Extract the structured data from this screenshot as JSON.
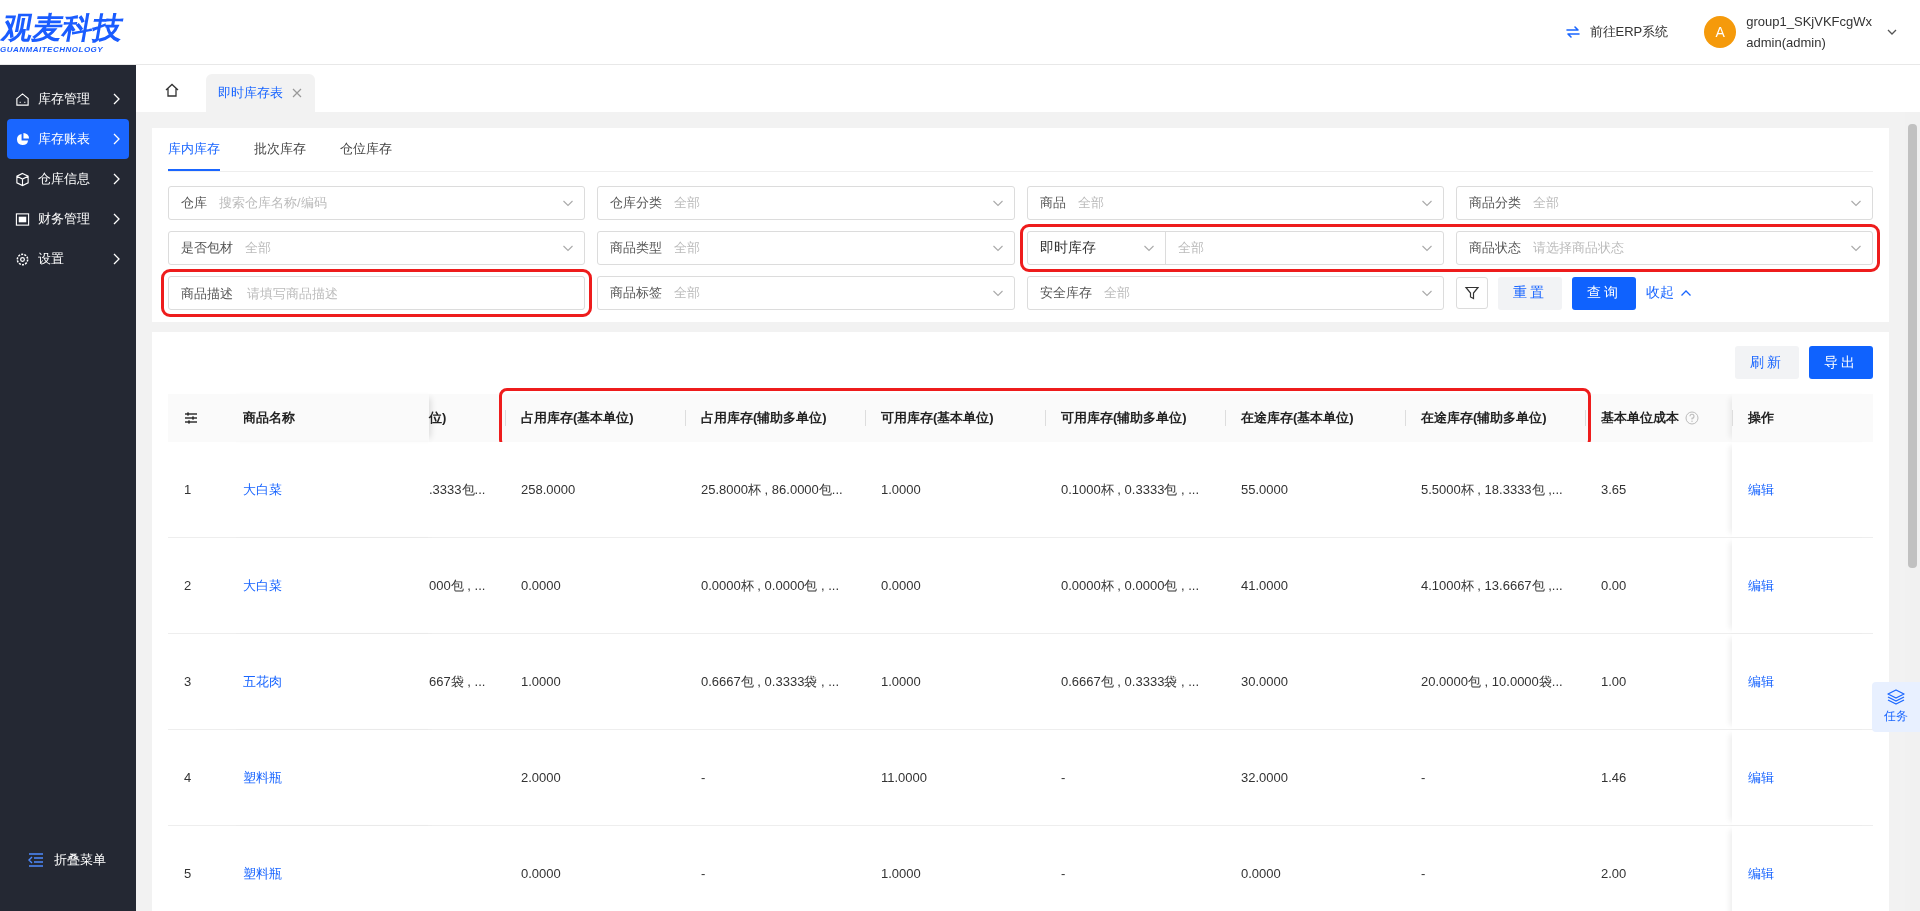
{
  "header": {
    "logo_title": "观麦科技",
    "logo_subtitle": "GUANMAITECHNOLOGY",
    "erp_link": "前往ERP系统",
    "avatar_letter": "A",
    "user_group": "group1_SKjVKFcgWx",
    "user_name": "admin(admin)"
  },
  "sidebar": {
    "items": [
      {
        "label": "库存管理",
        "selected": false
      },
      {
        "label": "库存账表",
        "selected": true
      },
      {
        "label": "仓库信息",
        "selected": false
      },
      {
        "label": "财务管理",
        "selected": false
      },
      {
        "label": "设置",
        "selected": false
      }
    ],
    "collapse_label": "折叠菜单"
  },
  "page_tabs": [
    {
      "label": "即时库存表",
      "selected": true
    }
  ],
  "view_tabs": [
    {
      "label": "库内库存",
      "selected": true
    },
    {
      "label": "批次库存",
      "selected": false
    },
    {
      "label": "仓位库存",
      "selected": false
    }
  ],
  "filters": {
    "rows": [
      [
        {
          "kind": "select",
          "label": "仓库",
          "placeholder": "搜索仓库名称/编码",
          "highlighted": false
        },
        {
          "kind": "select",
          "label": "仓库分类",
          "placeholder": "全部",
          "highlighted": false
        },
        {
          "kind": "select",
          "label": "商品",
          "placeholder": "全部",
          "highlighted": false
        },
        {
          "kind": "select",
          "label": "商品分类",
          "placeholder": "全部",
          "highlighted": false
        }
      ],
      [
        {
          "kind": "select",
          "label": "是否包材",
          "placeholder": "全部",
          "highlighted": false
        },
        {
          "kind": "select",
          "label": "商品类型",
          "placeholder": "全部",
          "highlighted": false
        },
        {
          "kind": "split",
          "label": "即时库存",
          "placeholder": "全部",
          "highlighted": true
        },
        {
          "kind": "select",
          "label": "商品状态",
          "placeholder": "请选择商品状态",
          "highlighted": true
        }
      ],
      [
        {
          "kind": "input",
          "label": "商品描述",
          "placeholder": "请填写商品描述",
          "highlighted": true
        },
        {
          "kind": "select",
          "label": "商品标签",
          "placeholder": "全部",
          "highlighted": false
        },
        {
          "kind": "select",
          "label": "安全库存",
          "placeholder": "全部",
          "highlighted": false
        }
      ]
    ],
    "reset": "重置",
    "query": "查询",
    "collapse": "收起"
  },
  "table": {
    "refresh": "刷新",
    "export": "导出",
    "columns": [
      {
        "label": "商品名称",
        "kind": "link",
        "highlighted": false
      },
      {
        "label": "位)",
        "kind": "clipped",
        "highlighted": false
      },
      {
        "label": "占用库存(基本单位)",
        "kind": "text",
        "highlighted": true
      },
      {
        "label": "占用库存(辅助多单位)",
        "kind": "text",
        "highlighted": true
      },
      {
        "label": "可用库存(基本单位)",
        "kind": "text",
        "highlighted": true
      },
      {
        "label": "可用库存(辅助多单位)",
        "kind": "text",
        "highlighted": true
      },
      {
        "label": "在途库存(基本单位)",
        "kind": "text",
        "highlighted": true
      },
      {
        "label": "在途库存(辅助多单位)",
        "kind": "text",
        "highlighted": true
      },
      {
        "label": "基本单位成本",
        "kind": "help",
        "highlighted": false
      },
      {
        "label": "操作",
        "kind": "action",
        "highlighted": false
      }
    ],
    "rows": [
      {
        "no": "1",
        "cells": [
          "大白菜",
          ".3333包...",
          "258.0000",
          "25.8000杯 , 86.0000包...",
          "1.0000",
          "0.1000杯 , 0.3333包 , ...",
          "55.0000",
          "5.5000杯 , 18.3333包 ,...",
          "3.65",
          "编辑"
        ]
      },
      {
        "no": "2",
        "cells": [
          "大白菜",
          "000包 , ...",
          "0.0000",
          "0.0000杯 , 0.0000包 , ...",
          "0.0000",
          "0.0000杯 , 0.0000包 , ...",
          "41.0000",
          "4.1000杯 , 13.6667包 ,...",
          "0.00",
          "编辑"
        ]
      },
      {
        "no": "3",
        "cells": [
          "五花肉",
          "667袋 , ...",
          "1.0000",
          "0.6667包 , 0.3333袋 , ...",
          "1.0000",
          "0.6667包 , 0.3333袋 , ...",
          "30.0000",
          "20.0000包 , 10.0000袋...",
          "1.00",
          "编辑"
        ]
      },
      {
        "no": "4",
        "cells": [
          "塑料瓶",
          null,
          "2.0000",
          "-",
          "11.0000",
          "-",
          "32.0000",
          "-",
          "1.46",
          "编辑"
        ]
      },
      {
        "no": "5",
        "cells": [
          "塑料瓶",
          null,
          "0.0000",
          "-",
          "1.0000",
          "-",
          "0.0000",
          "-",
          "2.00",
          "编辑"
        ]
      }
    ]
  },
  "task_button": "任务"
}
